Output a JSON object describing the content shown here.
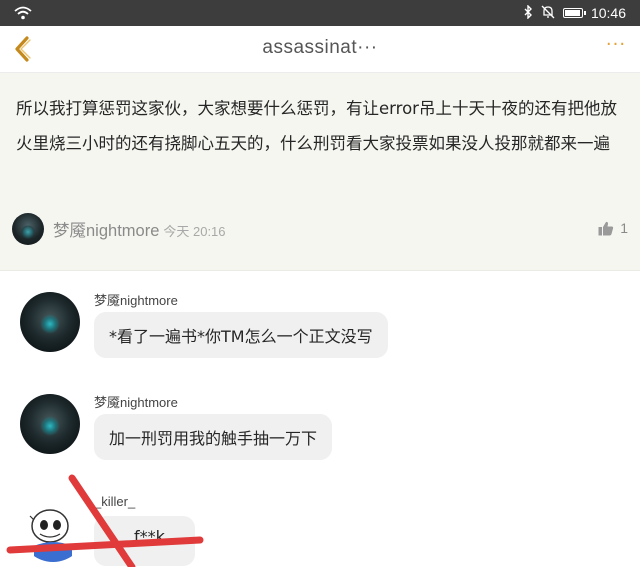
{
  "status_bar": {
    "time": "10:46",
    "icons": [
      "wifi-icon",
      "bluetooth-icon",
      "bell-off-icon",
      "battery-icon"
    ],
    "battery_level": 0.9
  },
  "header": {
    "title": "assassinat···",
    "more_label": "···",
    "accent_color": "#e3a336"
  },
  "post": {
    "text": "所以我打算惩罚这家伙，大家想要什么惩罚，有让error吊上十天十夜的还有把他放火里烧三小时的还有挠脚心五天的，什么刑罚看大家投票如果没人投那就都来一遍",
    "author": "梦魇nightmore",
    "time": "今天 20:16",
    "likes": "1"
  },
  "comments": [
    {
      "author": "梦魇nightmore",
      "text": "*看了一遍书*你TM怎么一个正文没写"
    },
    {
      "author": "梦魇nightmore",
      "text": "加一刑罚用我的触手抽一万下"
    },
    {
      "author": "_killer_",
      "text": "f**k"
    }
  ],
  "overlay": {
    "type": "red-cross",
    "color": "#e03a3a"
  }
}
